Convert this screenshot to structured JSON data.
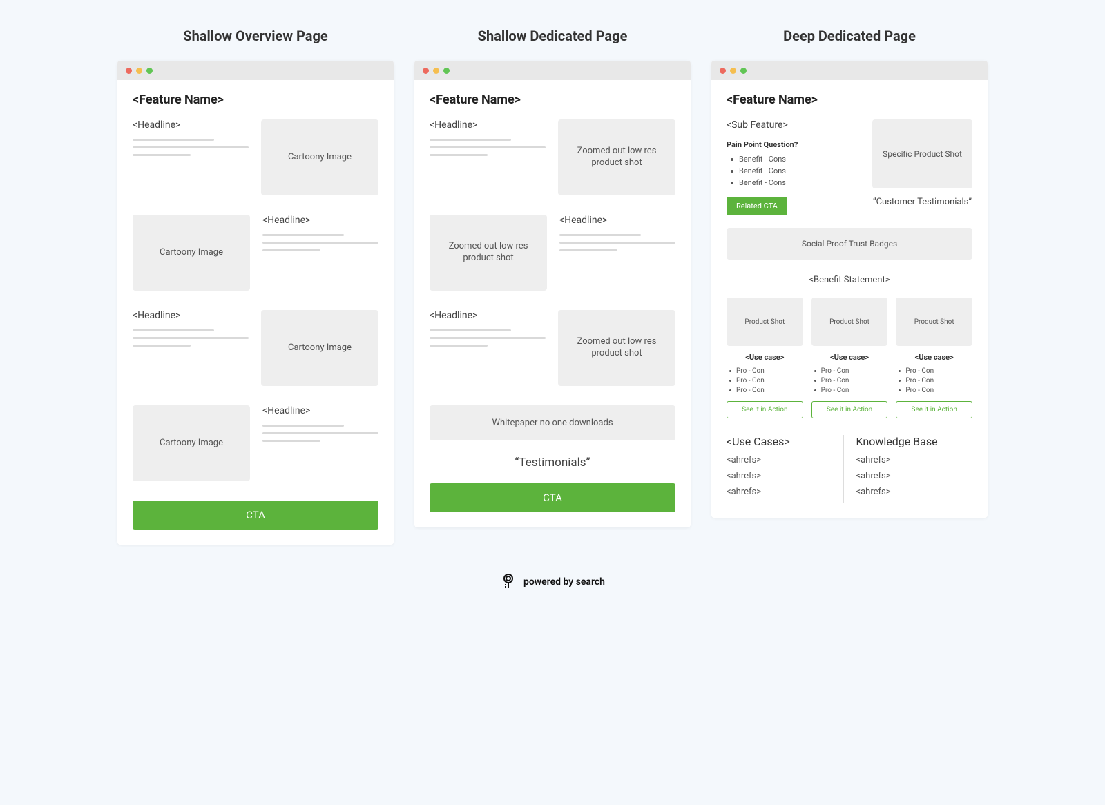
{
  "columns": [
    {
      "title": "Shallow Overview Page",
      "feature": "<Feature Name>",
      "rows": [
        {
          "headline": "<Headline>",
          "image": "Cartoony Image",
          "imgside": "right"
        },
        {
          "headline": "<Headline>",
          "image": "Cartoony Image",
          "imgside": "left"
        },
        {
          "headline": "<Headline>",
          "image": "Cartoony Image",
          "imgside": "right"
        },
        {
          "headline": "<Headline>",
          "image": "Cartoony Image",
          "imgside": "left"
        }
      ],
      "cta": "CTA"
    },
    {
      "title": "Shallow Dedicated Page",
      "feature": "<Feature Name>",
      "rows": [
        {
          "headline": "<Headline>",
          "image": "Zoomed out low res product shot",
          "imgside": "right"
        },
        {
          "headline": "<Headline>",
          "image": "Zoomed out low res product shot",
          "imgside": "left"
        },
        {
          "headline": "<Headline>",
          "image": "Zoomed out low res product shot",
          "imgside": "right"
        }
      ],
      "whitepaper": "Whitepaper no one downloads",
      "testimonials": "“Testimonials”",
      "cta": "CTA"
    },
    {
      "title": "Deep Dedicated Page",
      "feature": "<Feature Name>",
      "sub_feature": "<Sub Feature>",
      "pain_question": "Pain Point Question?",
      "benefits": [
        "Benefit - Cons",
        "Benefit - Cons",
        "Benefit - Cons"
      ],
      "related_cta": "Related CTA",
      "specific_shot": "Specific Product Shot",
      "customer_testimonials": "“Customer Testimonials”",
      "social_proof": "Social Proof Trust Badges",
      "benefit_statement": "<Benefit Statement>",
      "cards": [
        {
          "img": "Product Shot",
          "use": "<Use case>",
          "procons": [
            "Pro - Con",
            "Pro - Con",
            "Pro - Con"
          ],
          "cta": "See it in Action"
        },
        {
          "img": "Product Shot",
          "use": "<Use case>",
          "procons": [
            "Pro - Con",
            "Pro - Con",
            "Pro - Con"
          ],
          "cta": "See it in Action"
        },
        {
          "img": "Product Shot",
          "use": "<Use case>",
          "procons": [
            "Pro - Con",
            "Pro - Con",
            "Pro - Con"
          ],
          "cta": "See it in Action"
        }
      ],
      "use_cases_title": "<Use Cases>",
      "knowledge_title": "Knowledge Base",
      "use_cases_items": [
        "<ahrefs>",
        "<ahrefs>",
        "<ahrefs>"
      ],
      "knowledge_items": [
        "<ahrefs>",
        "<ahrefs>",
        "<ahrefs>"
      ]
    }
  ],
  "footer": "powered by search"
}
